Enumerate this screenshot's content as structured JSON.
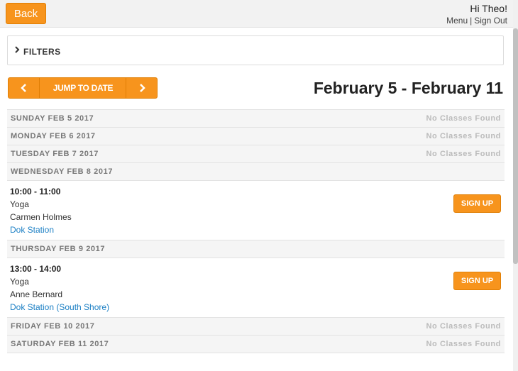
{
  "header": {
    "back_label": "Back",
    "greeting": "Hi Theo!",
    "menu_label": "Menu",
    "separator": "|",
    "signout_label": "Sign Out"
  },
  "filters": {
    "label": "FILTERS"
  },
  "nav": {
    "prev_icon": "chevron-left-icon",
    "next_icon": "chevron-right-icon",
    "jump_label": "JUMP TO DATE",
    "week_title": "February 5 - February 11"
  },
  "days": [
    {
      "label": "SUNDAY FEB 5 2017",
      "empty_text": "No Classes Found"
    },
    {
      "label": "MONDAY FEB 6 2017",
      "empty_text": "No Classes Found"
    },
    {
      "label": "TUESDAY FEB 7 2017",
      "empty_text": "No Classes Found"
    },
    {
      "label": "WEDNESDAY FEB 8 2017",
      "empty_text": ""
    },
    {
      "label": "THURSDAY FEB 9 2017",
      "empty_text": ""
    },
    {
      "label": "FRIDAY FEB 10 2017",
      "empty_text": "No Classes Found"
    },
    {
      "label": "SATURDAY FEB 11 2017",
      "empty_text": "No Classes Found"
    }
  ],
  "classes": [
    {
      "time": "10:00 - 11:00",
      "name": "Yoga",
      "teacher": "Carmen Holmes",
      "location": "Dok Station",
      "signup_label": "SIGN UP"
    },
    {
      "time": "13:00 - 14:00",
      "name": "Yoga",
      "teacher": "Anne Bernard",
      "location": "Dok Station (South Shore)",
      "signup_label": "SIGN UP"
    }
  ],
  "colors": {
    "accent": "#f7941d",
    "link": "#1b7fc4"
  }
}
